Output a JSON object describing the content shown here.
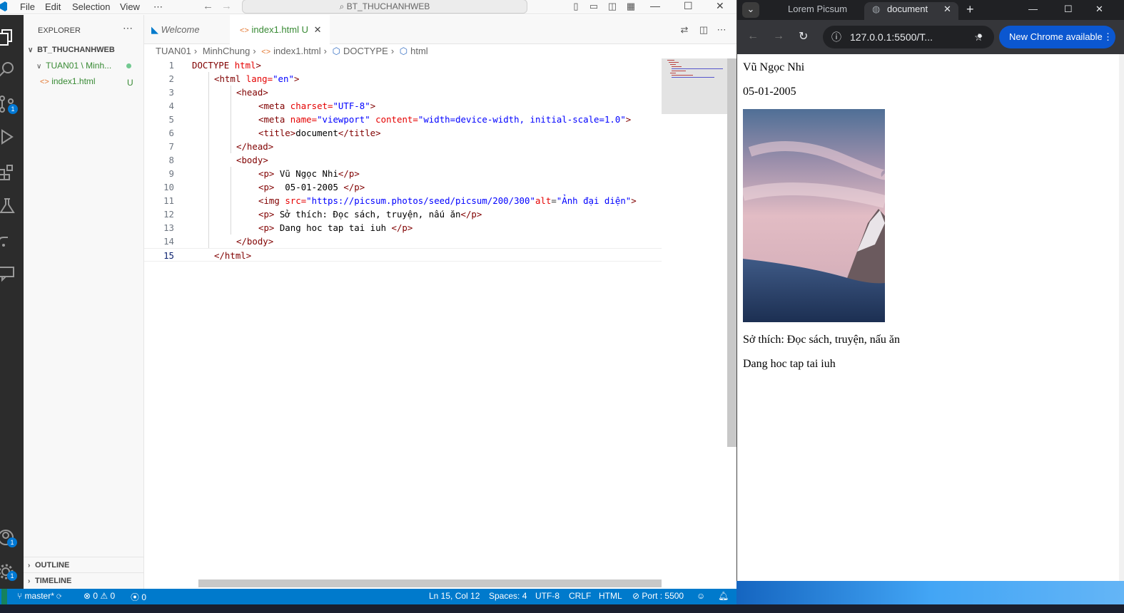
{
  "vscode": {
    "menu": [
      "File",
      "Edit",
      "Selection",
      "View",
      "⋯"
    ],
    "search_text": "BT_THUCHANHWEB",
    "explorer": {
      "title": "EXPLORER",
      "root": "BT_THUCHANHWEB",
      "folder": "TUAN01 \\ Minh...",
      "file": "index1.html",
      "file_status": "U",
      "sections": [
        "OUTLINE",
        "TIMELINE"
      ]
    },
    "tabs": [
      {
        "label": "Welcome",
        "active": false
      },
      {
        "label": "index1.html",
        "status": "U",
        "active": true
      }
    ],
    "breadcrumb": [
      "TUAN01",
      "MinhChung",
      "index1.html",
      "DOCTYPE",
      "html"
    ],
    "badges": {
      "scm": "1",
      "accounts": "1",
      "settings": "1"
    },
    "code_lines": [
      "DOCTYPE html>",
      "<html lang=\"en\">",
      "<head>",
      "<meta charset=\"UTF-8\">",
      "<meta name=\"viewport\" content=\"width=device-width, initial-scale=1.0\">",
      "<title>document</title>",
      "</head>",
      "<body>",
      "<p> Vũ Ngọc Nhi</p>",
      "<p>  05-01-2005 </p>",
      "<img src=\"https://picsum.photos/seed/picsum/200/300\"alt=\"Ảnh đại diện\">",
      "<p> Sở thích: Đọc sách, truyện, nấu ăn</p>",
      "<p> Dang hoc tap tai iuh </p>",
      "</body>",
      "</html>"
    ],
    "status": {
      "branch": "master*",
      "errors": "0",
      "warnings": "0",
      "ports": "0",
      "position": "Ln 15, Col 12",
      "spaces": "Spaces: 4",
      "encoding": "UTF-8",
      "eol": "CRLF",
      "language": "HTML",
      "port": "Port : 5500"
    }
  },
  "chrome": {
    "tabs": [
      {
        "label": "Lorem Picsum",
        "active": false
      },
      {
        "label": "document",
        "active": true
      }
    ],
    "url": "127.0.0.1:5500/T...",
    "update_label": "New Chrome available",
    "page": {
      "name": "Vũ Ngọc Nhi",
      "date": "05-01-2005",
      "hobby": "Sở thích: Đọc sách, truyện, nấu ăn",
      "study": "Dang hoc tap tai iuh"
    }
  },
  "colors": {
    "accent": "#007acc",
    "tag": "#800000",
    "attr": "#e50000",
    "string": "#0000ff",
    "chrome_update": "#0b57d0"
  }
}
